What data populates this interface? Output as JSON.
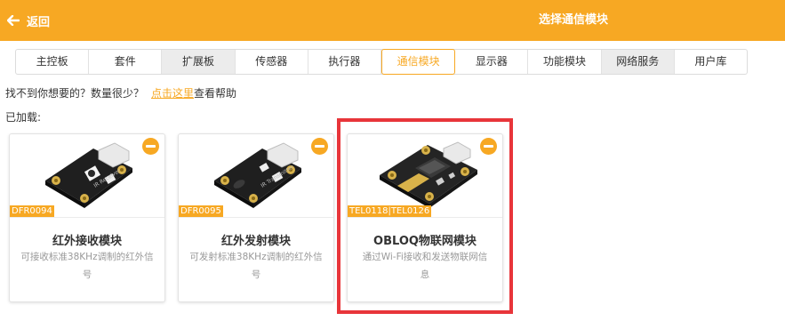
{
  "header": {
    "back_label": "返回",
    "title": "选择通信模块",
    "accent_color": "#f7a823"
  },
  "tabs": [
    {
      "label": "主控板",
      "state": "normal"
    },
    {
      "label": "套件",
      "state": "normal"
    },
    {
      "label": "扩展板",
      "state": "gray"
    },
    {
      "label": "传感器",
      "state": "normal"
    },
    {
      "label": "执行器",
      "state": "normal"
    },
    {
      "label": "通信模块",
      "state": "active"
    },
    {
      "label": "显示器",
      "state": "normal"
    },
    {
      "label": "功能模块",
      "state": "normal"
    },
    {
      "label": "网络服务",
      "state": "gray"
    },
    {
      "label": "用户库",
      "state": "normal"
    }
  ],
  "help": {
    "text": "找不到你想要的？数量很少？",
    "link_label": "点击这里",
    "suffix": "查看帮助"
  },
  "loaded_label": "已加载:",
  "cards": [
    {
      "sku": "DFR0094",
      "name": "红外接收模块",
      "desc": "可接收标准38KHz调制的红外信号",
      "image_icon": "ir-receiver-board-image",
      "remove_icon": "minus-circle-icon"
    },
    {
      "sku": "DFR0095",
      "name": "红外发射模块",
      "desc": "可发射标准38KHz调制的红外信号",
      "image_icon": "ir-transmitter-board-image",
      "remove_icon": "minus-circle-icon"
    },
    {
      "sku": "TEL0118|TEL0126",
      "name": "OBLOQ物联网模块",
      "desc": "通过Wi-Fi接收和发送物联网信息",
      "image_icon": "obloq-board-image",
      "remove_icon": "minus-circle-icon",
      "highlighted": true
    }
  ],
  "colors": {
    "highlight_border": "#e8353a",
    "tab_gray": "#ececec"
  }
}
